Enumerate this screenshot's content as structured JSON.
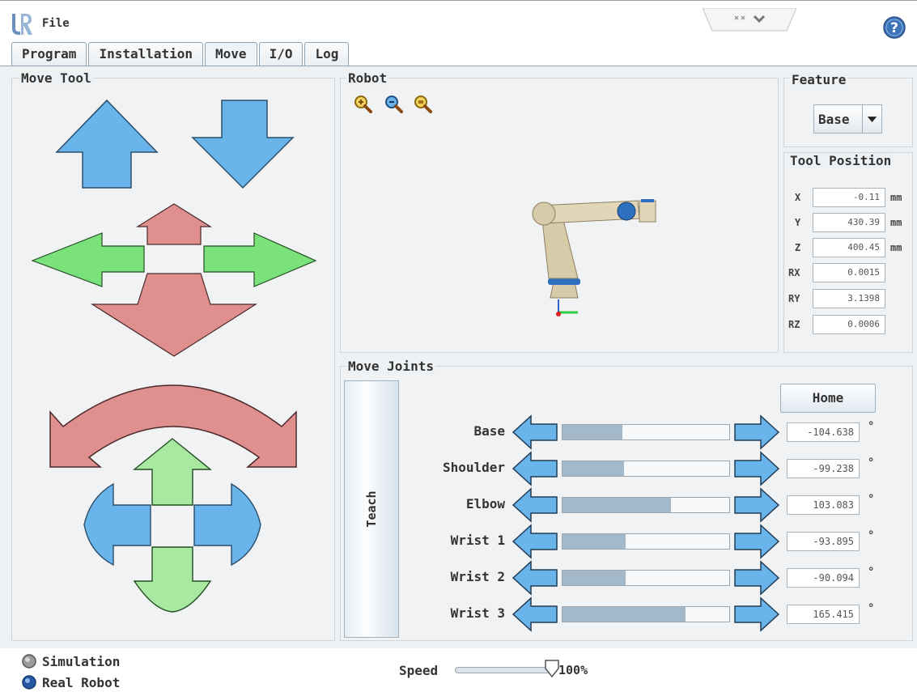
{
  "menu": {
    "file": "File"
  },
  "tabs": [
    {
      "label": "Program"
    },
    {
      "label": "Installation"
    },
    {
      "label": "Move",
      "active": true
    },
    {
      "label": "I/O"
    },
    {
      "label": "Log"
    }
  ],
  "move_tool": {
    "title": "Move Tool"
  },
  "robot": {
    "title": "Robot"
  },
  "feature": {
    "title": "Feature",
    "selected": "Base"
  },
  "tool_position": {
    "title": "Tool Position",
    "rows": [
      {
        "label": "X",
        "value": "-0.11",
        "unit": "mm"
      },
      {
        "label": "Y",
        "value": "430.39",
        "unit": "mm"
      },
      {
        "label": "Z",
        "value": "400.45",
        "unit": "mm"
      },
      {
        "label": "RX",
        "value": "0.0015"
      },
      {
        "label": "RY",
        "value": "3.1398"
      },
      {
        "label": "RZ",
        "value": "0.0006"
      }
    ]
  },
  "move_joints": {
    "title": "Move Joints",
    "teach_label": "Teach",
    "home_label": "Home",
    "unit": "°",
    "joints": [
      {
        "name": "Base",
        "value": "-104.638",
        "level": 0.36
      },
      {
        "name": "Shoulder",
        "value": "-99.238",
        "level": 0.37
      },
      {
        "name": "Elbow",
        "value": "103.083",
        "level": 0.65
      },
      {
        "name": "Wrist 1",
        "value": "-93.895",
        "level": 0.38
      },
      {
        "name": "Wrist 2",
        "value": "-90.094",
        "level": 0.38
      },
      {
        "name": "Wrist 3",
        "value": "165.415",
        "level": 0.74
      }
    ]
  },
  "mode": {
    "simulation": "Simulation",
    "real_robot": "Real Robot"
  },
  "speed": {
    "label": "Speed",
    "value": "100%",
    "level": 1.0
  },
  "colors": {
    "blue_arrow": "#6ab4ec",
    "green_arrow": "#7be27b",
    "red_arrow": "#e08f8f",
    "fill_bar": "#a3b8c9"
  },
  "icons": [
    "ur-logo-icon",
    "window-control-icon",
    "help-icon",
    "zoom-in-icon",
    "zoom-out-icon",
    "zoom-fit-icon",
    "radio-icon"
  ]
}
